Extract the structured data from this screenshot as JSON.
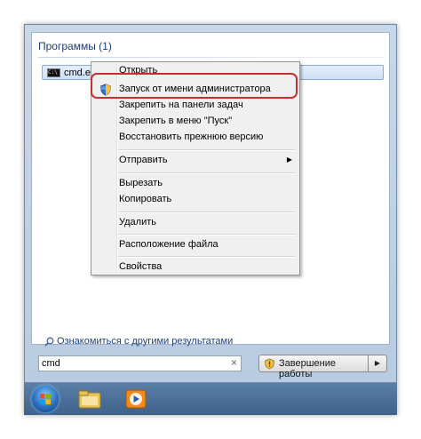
{
  "programs": {
    "header": "Программы (1)",
    "result_label": "cmd.exe"
  },
  "context_menu": {
    "items": [
      {
        "label": "Открыть",
        "has_submenu": false
      },
      {
        "label": "Запуск от имени администратора",
        "icon": "uac-shield-icon",
        "has_submenu": false
      },
      {
        "label": "Закрепить на панели задач",
        "has_submenu": false
      },
      {
        "label": "Закрепить в меню \"Пуск\"",
        "has_submenu": false
      },
      {
        "label": "Восстановить прежнюю версию",
        "has_submenu": false
      },
      {
        "label": "Отправить",
        "has_submenu": true
      },
      {
        "label": "Вырезать",
        "has_submenu": false
      },
      {
        "label": "Копировать",
        "has_submenu": false
      },
      {
        "label": "Удалить",
        "has_submenu": false
      },
      {
        "label": "Расположение файла",
        "has_submenu": false
      },
      {
        "label": "Свойства",
        "has_submenu": false
      }
    ],
    "highlight_color": "#c9302c"
  },
  "see_more": {
    "label": "Ознакомиться с другими результатами"
  },
  "search": {
    "value": "cmd",
    "clear_glyph": "×"
  },
  "shutdown": {
    "label": "Завершение работы",
    "arrow_glyph": "▶"
  },
  "submenu_arrow_glyph": "▶",
  "taskbar": {
    "icons": [
      "windows-start-orb",
      "explorer-folder-icon",
      "media-player-icon"
    ]
  }
}
